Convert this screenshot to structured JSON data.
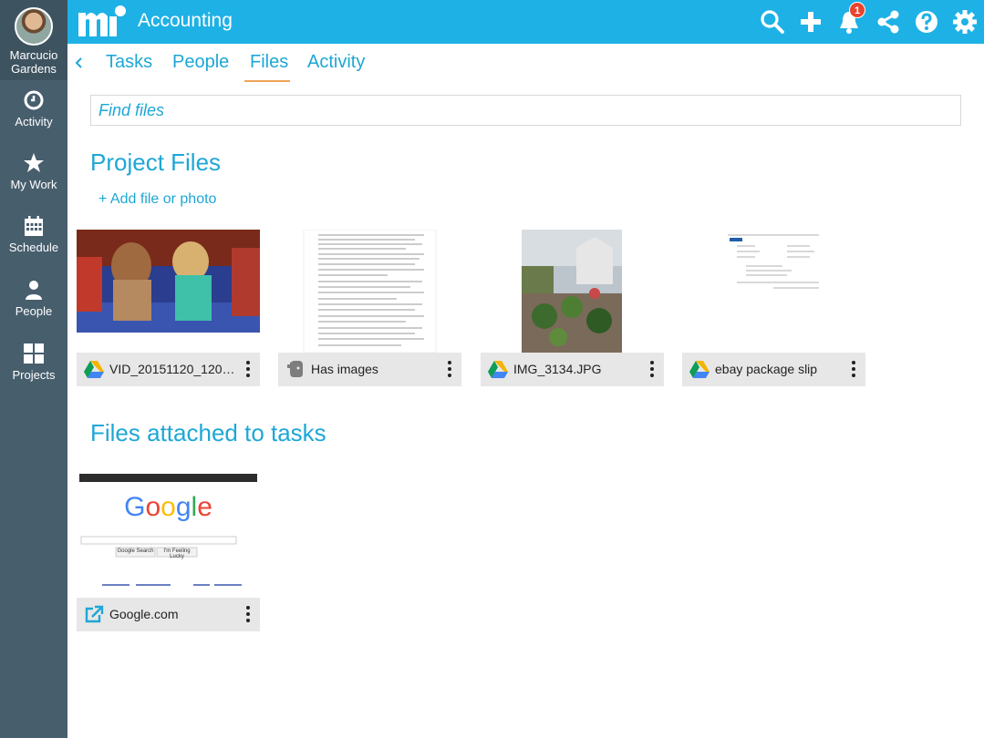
{
  "user": {
    "name": "Marcucio Gardens"
  },
  "sidebar": {
    "items": [
      {
        "label": "Activity",
        "icon": "clock-icon"
      },
      {
        "label": "My Work",
        "icon": "star-icon"
      },
      {
        "label": "Schedule",
        "icon": "calendar-icon"
      },
      {
        "label": "People",
        "icon": "person-icon"
      },
      {
        "label": "Projects",
        "icon": "grid-icon"
      }
    ]
  },
  "topbar": {
    "title": "Accounting",
    "notification_count": "1",
    "icons": [
      "search-icon",
      "plus-icon",
      "bell-icon",
      "share-icon",
      "help-icon",
      "gear-icon"
    ]
  },
  "tabs": [
    {
      "label": "Tasks"
    },
    {
      "label": "People"
    },
    {
      "label": "Files",
      "active": true
    },
    {
      "label": "Activity"
    }
  ],
  "search": {
    "placeholder": "Find files"
  },
  "project_files": {
    "title": "Project Files",
    "add_label": "+ Add file or photo",
    "files": [
      {
        "name": "VID_20151120_1206…",
        "source": "google-drive-icon"
      },
      {
        "name": "Has images",
        "source": "evernote-icon"
      },
      {
        "name": "IMG_3134.JPG",
        "source": "google-drive-icon"
      },
      {
        "name": "ebay package slip",
        "source": "google-drive-icon"
      }
    ]
  },
  "task_files": {
    "title": "Files attached to tasks",
    "files": [
      {
        "name": "Google.com",
        "source": "external-link-icon"
      }
    ]
  },
  "google_thumb": {
    "logo": "Google",
    "search_btn": "Google Search",
    "lucky_btn": "I'm Feeling Lucky"
  },
  "colors": {
    "accent": "#1eb1e6",
    "sidebar": "#475e6d",
    "tab_underline": "#f0a35a",
    "badge": "#e8442e"
  }
}
